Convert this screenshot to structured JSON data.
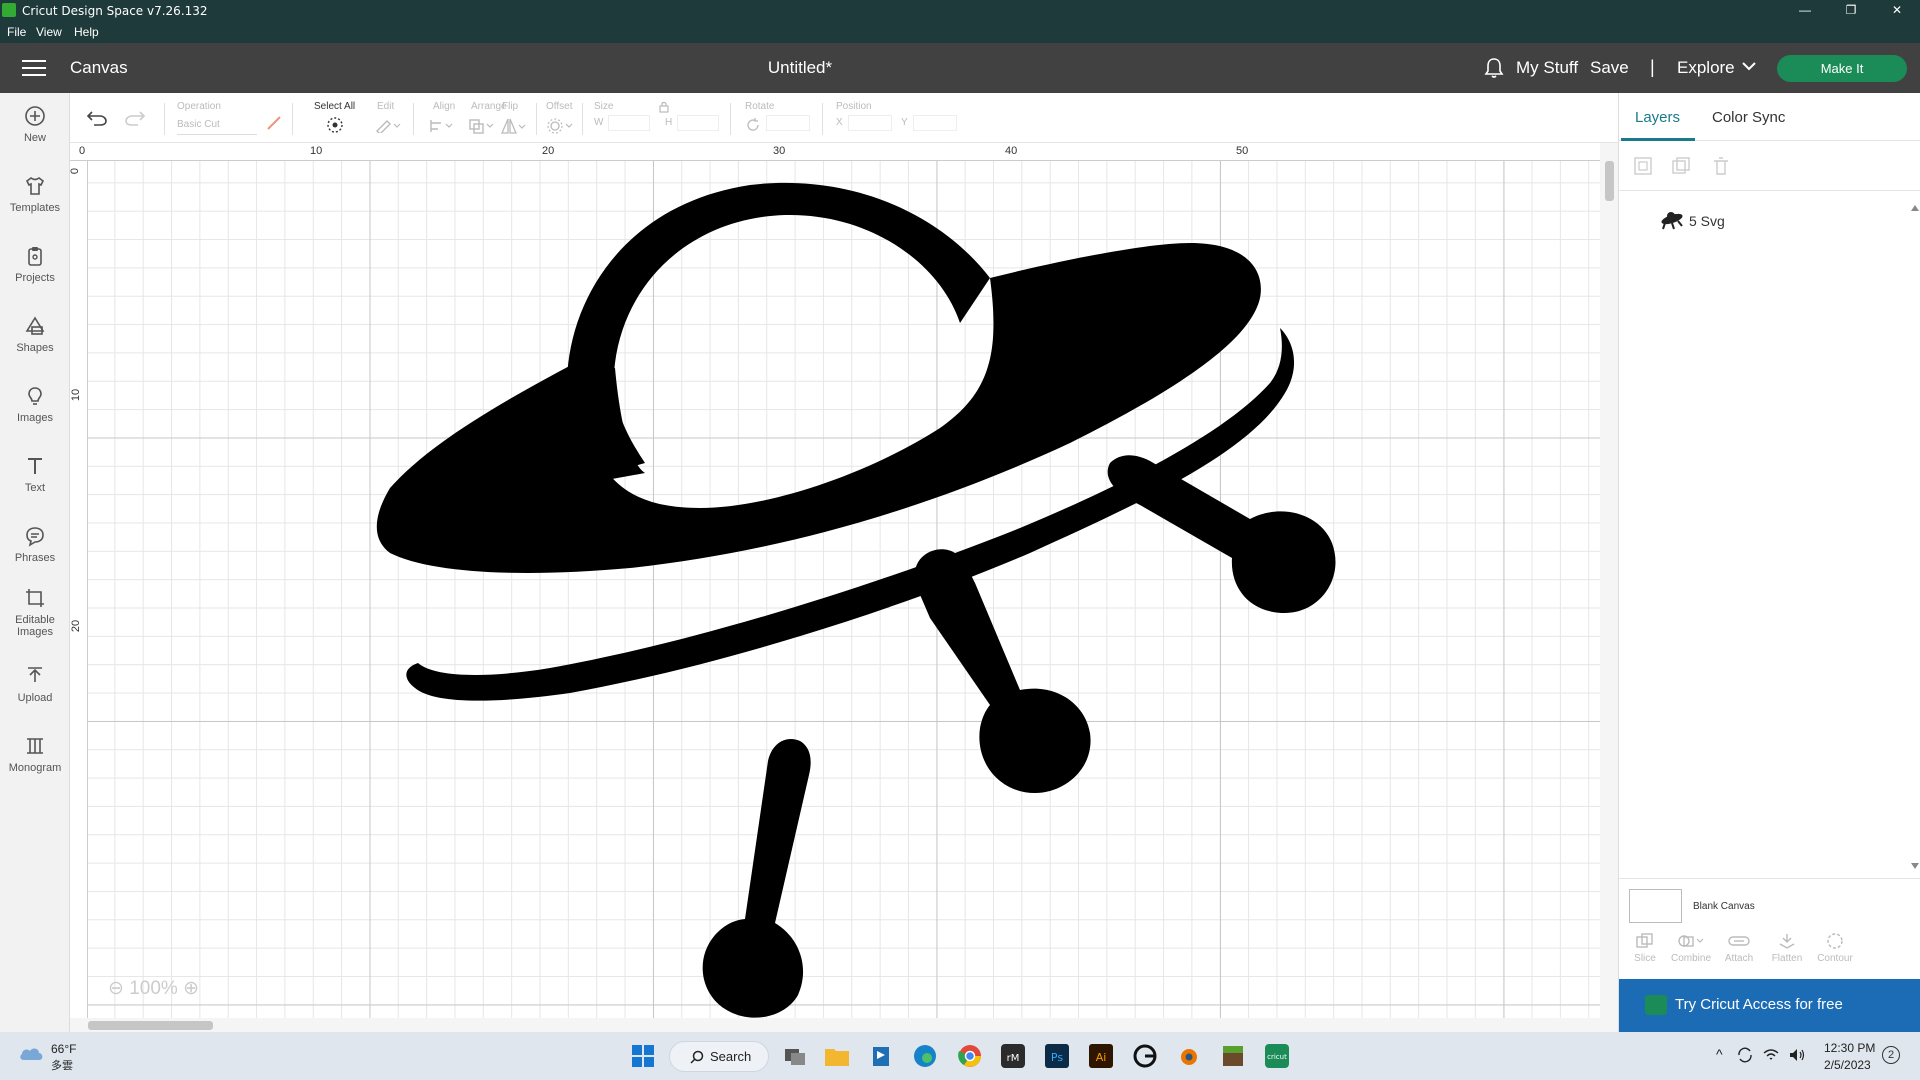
{
  "window": {
    "title": "Cricut Design Space  v7.26.132",
    "minimize": "—",
    "restore": "❐",
    "close": "✕"
  },
  "menu": [
    "File",
    "View",
    "Help"
  ],
  "header": {
    "canvas_label": "Canvas",
    "doc_title": "Untitled*",
    "my_stuff": "My Stuff",
    "save": "Save",
    "separator": "|",
    "explore": "Explore",
    "make_it": "Make It"
  },
  "sidebar": {
    "items": [
      {
        "label": "New",
        "icon": "plus-circle-icon"
      },
      {
        "label": "Templates",
        "icon": "shirt-icon"
      },
      {
        "label": "Projects",
        "icon": "clipboard-icon"
      },
      {
        "label": "Shapes",
        "icon": "shapes-icon"
      },
      {
        "label": "Images",
        "icon": "lightbulb-icon"
      },
      {
        "label": "Text",
        "icon": "text-icon"
      },
      {
        "label": "Phrases",
        "icon": "speech-bubble-icon"
      },
      {
        "label": "Editable Images",
        "icon": "edit-image-icon"
      },
      {
        "label": "Upload",
        "icon": "upload-icon"
      },
      {
        "label": "Monogram",
        "icon": "monogram-icon"
      }
    ]
  },
  "toolbar": {
    "operation_label": "Operation",
    "operation_value": "Basic Cut",
    "select_all_label": "Select All",
    "edit_label": "Edit",
    "align_label": "Align",
    "arrange_label": "Arrange",
    "flip_label": "Flip",
    "offset_label": "Offset",
    "size_label": "Size",
    "size_w": "W",
    "size_h": "H",
    "rotate_label": "Rotate",
    "position_label": "Position",
    "pos_x": "X",
    "pos_y": "Y"
  },
  "canvas": {
    "ruler_top": [
      "0",
      "10",
      "20",
      "30",
      "40",
      "50"
    ],
    "ruler_left": [
      "0",
      "10",
      "20"
    ],
    "zoom": "100%",
    "zoom_minus": "⊖",
    "zoom_plus": "⊕"
  },
  "right_panel": {
    "tabs": [
      "Layers",
      "Color Sync"
    ],
    "active_tab": "Layers",
    "layer_name": "5 Svg",
    "blank_canvas": "Blank Canvas",
    "actions": [
      "Slice",
      "Combine",
      "Attach",
      "Flatten",
      "Contour"
    ],
    "access_cta": "Try Cricut Access for free"
  },
  "taskbar": {
    "temperature": "66°F",
    "condition": "多雲",
    "search": "Search",
    "time": "12:30 PM",
    "date": "2/5/2023",
    "notifications": "2"
  },
  "colors": {
    "accent": "#1b8b57",
    "header_bg": "#414141",
    "access_bg": "#1c6bb5",
    "tab_active": "#1a7a8c"
  }
}
